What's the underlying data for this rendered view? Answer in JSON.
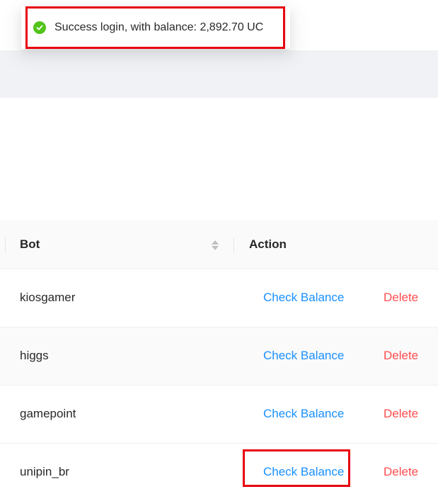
{
  "notification": {
    "message": "Success login, with balance: 2,892.70 UC",
    "icon": "check-circle-icon",
    "icon_color": "#52c41a"
  },
  "table": {
    "columns": {
      "bot": "Bot",
      "action": "Action"
    },
    "rows": [
      {
        "bot": "kiosgamer",
        "check_label": "Check Balance",
        "delete_label": "Delete"
      },
      {
        "bot": "higgs",
        "check_label": "Check Balance",
        "delete_label": "Delete"
      },
      {
        "bot": "gamepoint",
        "check_label": "Check Balance",
        "delete_label": "Delete"
      },
      {
        "bot": "unipin_br",
        "check_label": "Check Balance",
        "delete_label": "Delete"
      }
    ]
  },
  "colors": {
    "link": "#1890ff",
    "danger": "#ff4d4f",
    "highlight": "#e8000f",
    "success": "#52c41a"
  }
}
